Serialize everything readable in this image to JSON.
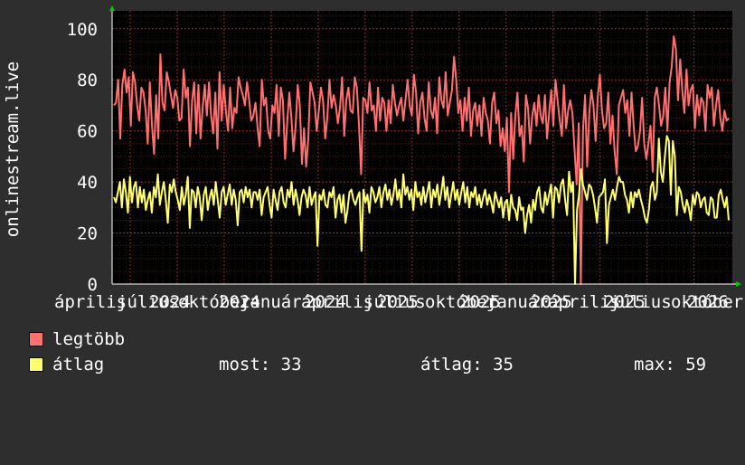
{
  "chart_data": {
    "type": "line",
    "ylabel": "onlinestream.live",
    "ylim": [
      0,
      107
    ],
    "yticks": [
      0,
      20,
      40,
      60,
      80,
      100
    ],
    "xticks": [
      "április",
      "július",
      "október",
      "január",
      "április",
      "július",
      "október",
      "január",
      "április",
      "július",
      "október",
      "január",
      "április"
    ],
    "xticks_display": [
      "április",
      "július",
      "október",
      "január",
      "április",
      "július",
      "október",
      "január",
      "április",
      "július",
      "október",
      "január",
      "április"
    ],
    "year_labels": [
      "2024",
      "2024",
      "2024",
      "2025",
      "2025",
      "2025",
      "2025",
      "2026"
    ],
    "x_tick_labels_rendered": [
      "áprilisjúliusoktóberjanuáráprilisjúliusoktóberjanuár 2026"
    ],
    "grid": true,
    "colors": {
      "legtobb": "#ff7070",
      "atlag": "#ffff70",
      "grid": "#9e2a2a",
      "axis": "#ffffff",
      "arrow": "#00cc00"
    },
    "series": [
      {
        "name": "legtöbb",
        "values": [
          70,
          71,
          80,
          57,
          78,
          84,
          75,
          81,
          62,
          83,
          79,
          70,
          64,
          77,
          75,
          68,
          55,
          79,
          62,
          51,
          74,
          57,
          90,
          71,
          68,
          83,
          79,
          74,
          69,
          76,
          73,
          64,
          65,
          84,
          73,
          77,
          54,
          72,
          79,
          59,
          78,
          57,
          69,
          78,
          66,
          79,
          66,
          59,
          75,
          53,
          83,
          64,
          78,
          68,
          60,
          77,
          61,
          69,
          67,
          81,
          77,
          74,
          70,
          79,
          72,
          64,
          66,
          71,
          61,
          54,
          80,
          70,
          73,
          60,
          57,
          70,
          67,
          78,
          58,
          77,
          72,
          49,
          63,
          75,
          65,
          52,
          62,
          78,
          70,
          47,
          61,
          46,
          57,
          79,
          75,
          71,
          60,
          68,
          77,
          72,
          57,
          65,
          80,
          69,
          74,
          70,
          63,
          69,
          81,
          58,
          72,
          77,
          68,
          67,
          81,
          77,
          62,
          43,
          73,
          72,
          67,
          79,
          68,
          70,
          60,
          77,
          64,
          73,
          71,
          60,
          72,
          63,
          78,
          71,
          66,
          70,
          73,
          64,
          72,
          80,
          70,
          66,
          82,
          75,
          59,
          71,
          75,
          65,
          60,
          79,
          68,
          65,
          73,
          59,
          81,
          72,
          69,
          83,
          66,
          71,
          76,
          89,
          80,
          67,
          72,
          60,
          73,
          64,
          77,
          58,
          68,
          71,
          62,
          70,
          58,
          73,
          67,
          64,
          55,
          71,
          75,
          63,
          68,
          54,
          61,
          52,
          65,
          36,
          67,
          49,
          66,
          75,
          58,
          62,
          48,
          74,
          69,
          55,
          66,
          71,
          62,
          74,
          66,
          63,
          74,
          57,
          67,
          76,
          62,
          80,
          72,
          64,
          58,
          78,
          61,
          68,
          72,
          67,
          53,
          39,
          63,
          0,
          60,
          74,
          46,
          67,
          76,
          70,
          56,
          73,
          82,
          68,
          61,
          63,
          75,
          55,
          66,
          52,
          43,
          70,
          73,
          76,
          67,
          72,
          58,
          75,
          62,
          52,
          54,
          60,
          73,
          55,
          49,
          55,
          62,
          44,
          73,
          77,
          70,
          62,
          66,
          77,
          60,
          79,
          85,
          97,
          92,
          72,
          88,
          76,
          67,
          84,
          70,
          76,
          78,
          61,
          74,
          66,
          73,
          71,
          60,
          78,
          73,
          77,
          62,
          70,
          76,
          65,
          60,
          68,
          64,
          65
        ]
      },
      {
        "name": "átlag",
        "values": [
          34,
          32,
          36,
          40,
          30,
          41,
          36,
          28,
          42,
          32,
          38,
          40,
          30,
          38,
          32,
          37,
          29,
          33,
          36,
          28,
          38,
          34,
          43,
          31,
          36,
          40,
          33,
          24,
          39,
          36,
          41,
          36,
          33,
          29,
          38,
          31,
          35,
          42,
          22,
          37,
          36,
          30,
          38,
          34,
          25,
          35,
          38,
          29,
          34,
          37,
          31,
          40,
          33,
          26,
          36,
          38,
          31,
          35,
          39,
          31,
          37,
          33,
          23,
          36,
          37,
          32,
          38,
          34,
          37,
          30,
          36,
          36,
          33,
          37,
          27,
          34,
          36,
          38,
          31,
          26,
          37,
          33,
          29,
          36,
          38,
          32,
          30,
          37,
          34,
          40,
          31,
          37,
          33,
          27,
          34,
          37,
          35,
          30,
          38,
          31,
          34,
          36,
          15,
          35,
          33,
          37,
          31,
          30,
          36,
          34,
          38,
          26,
          33,
          35,
          28,
          35,
          24,
          29,
          36,
          37,
          33,
          31,
          34,
          36,
          13,
          37,
          32,
          35,
          28,
          38,
          36,
          32,
          34,
          38,
          30,
          36,
          39,
          33,
          37,
          31,
          35,
          41,
          33,
          37,
          30,
          43,
          35,
          38,
          33,
          37,
          29,
          40,
          34,
          36,
          31,
          38,
          32,
          36,
          40,
          30,
          37,
          34,
          39,
          31,
          36,
          42,
          33,
          38,
          30,
          35,
          40,
          33,
          37,
          31,
          36,
          40,
          32,
          38,
          30,
          36,
          34,
          38,
          31,
          35,
          30,
          34,
          37,
          31,
          35,
          32,
          28,
          36,
          33,
          30,
          34,
          26,
          32,
          33,
          25,
          35,
          30,
          29,
          25,
          34,
          29,
          30,
          20,
          27,
          31,
          24,
          33,
          29,
          36,
          38,
          30,
          28,
          36,
          31,
          35,
          39,
          26,
          38,
          37,
          32,
          39,
          41,
          33,
          27,
          44,
          36,
          40,
          0,
          29,
          35,
          45,
          39,
          36,
          33,
          39,
          38,
          35,
          30,
          24,
          34,
          35,
          36,
          41,
          16,
          31,
          34,
          37,
          33,
          38,
          42,
          40,
          40,
          35,
          33,
          28,
          36,
          30,
          36,
          34,
          37,
          33,
          30,
          26,
          24,
          29,
          38,
          40,
          33,
          36,
          57,
          44,
          40,
          50,
          58,
          56,
          35,
          56,
          50,
          27,
          38,
          36,
          31,
          28,
          33,
          30,
          25,
          35,
          31,
          36,
          35,
          30,
          33,
          34,
          28,
          27,
          34,
          33,
          26,
          26,
          35,
          37,
          33,
          30,
          34,
          25
        ]
      }
    ]
  },
  "legend": {
    "items": [
      {
        "label": "legtöbb",
        "color": "#ff7070"
      },
      {
        "label": "átlag",
        "color": "#ffff70"
      }
    ],
    "stats": {
      "now": "most: 33",
      "avg": "átlag: 35",
      "max": "max: 59"
    }
  }
}
